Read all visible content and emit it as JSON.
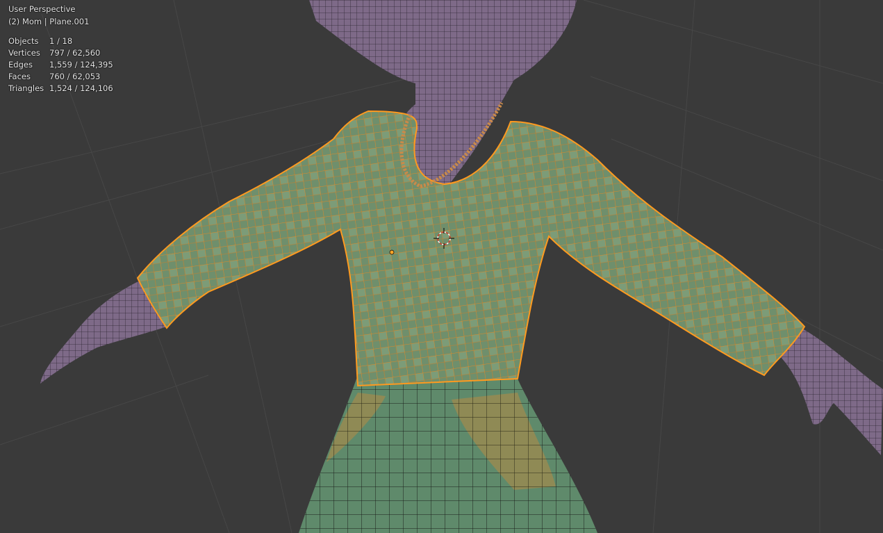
{
  "viewport": {
    "view_label": "User Perspective",
    "object_label": "(2) Mom | Plane.001",
    "colors": {
      "background": "#3a3a3a",
      "grid": "#474747",
      "skin": "#7e6a88",
      "shirt": "#6f8f6c",
      "shirt_light": "#86a783",
      "skirt": "#5f8a6b",
      "skirt_patch": "#8f8a55",
      "selection_outline": "#ff9a1f",
      "wire": "#1b1f1b"
    },
    "icons": {
      "cursor": "3d-cursor-icon",
      "origin": "object-origin-icon"
    }
  },
  "stats": [
    {
      "label": "Objects",
      "value": "1 / 18"
    },
    {
      "label": "Vertices",
      "value": "797 / 62,560"
    },
    {
      "label": "Edges",
      "value": "1,559 / 124,395"
    },
    {
      "label": "Faces",
      "value": "760 / 62,053"
    },
    {
      "label": "Triangles",
      "value": "1,524 / 124,106"
    }
  ]
}
